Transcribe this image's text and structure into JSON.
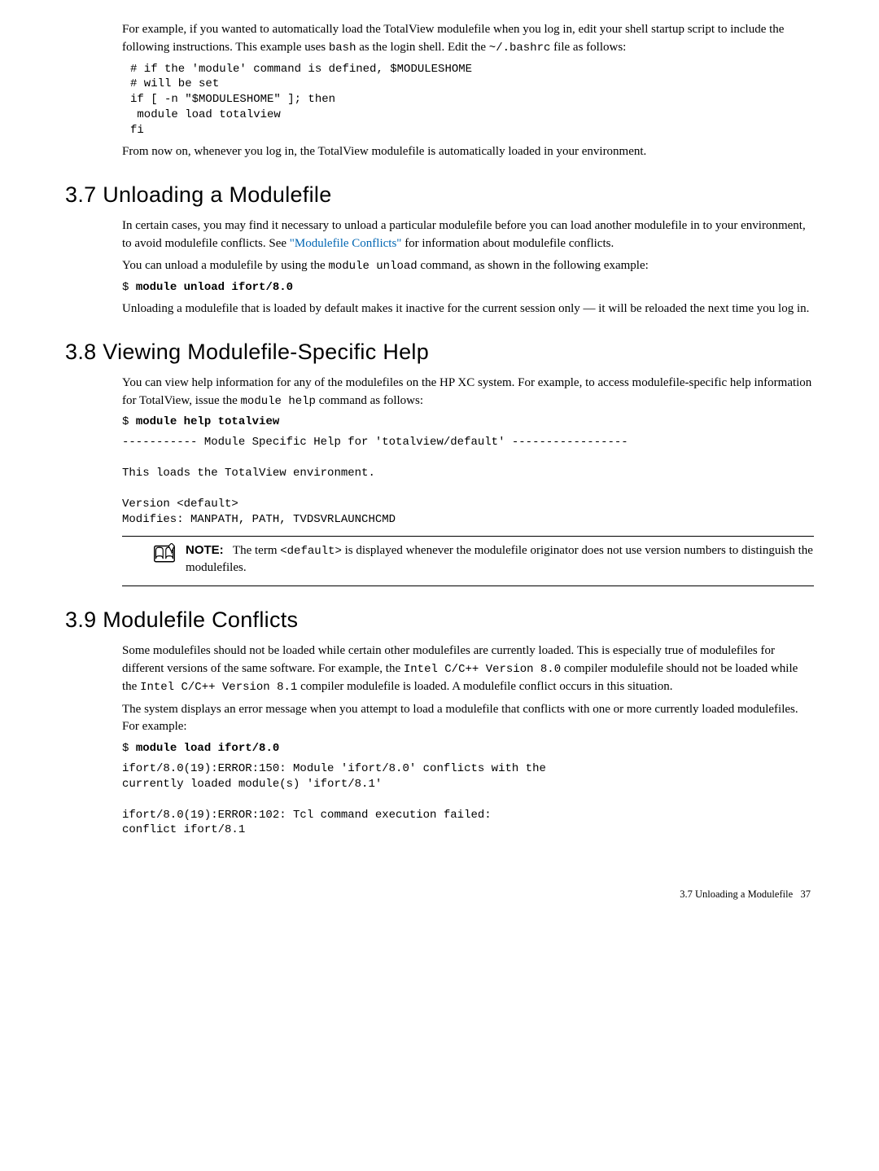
{
  "intro": {
    "p1": "For example, if you wanted to automatically load the TotalView modulefile when you log in, edit your shell startup script to include the following instructions. This example uses ",
    "p1_code1": "bash",
    "p1_mid": " as the login shell. Edit the ",
    "p1_code2": "~/.bashrc",
    "p1_end": " file as follows:",
    "codeblock": "# if the 'module' command is defined, $MODULESHOME\n# will be set\nif [ -n \"$MODULESHOME\" ]; then\n module load totalview\nfi",
    "p2": "From now on, whenever you log in, the TotalView modulefile is automatically loaded in your environment."
  },
  "sec37": {
    "number": "3.7",
    "title": "Unloading a Modulefile",
    "p1_a": "In certain cases, you may find it necessary to unload a particular modulefile before you can load another modulefile in to your environment, to avoid modulefile conflicts. See ",
    "p1_link": "\"Modulefile Conflicts\"",
    "p1_b": " for information about modulefile conflicts.",
    "p2_a": "You can unload a modulefile by using the ",
    "p2_code": "module unload",
    "p2_b": " command, as shown in the following example:",
    "code_prompt": "$ ",
    "code_cmd": "module unload ifort/8.0",
    "p3": "Unloading a modulefile that is loaded by default makes it inactive for the current session only — it will be reloaded the next time you log in."
  },
  "sec38": {
    "number": "3.8",
    "title": "Viewing Modulefile-Specific Help",
    "p1_a": "You can view help information for any of the modulefiles on the HP XC system. For example, to access modulefile-specific help information for TotalView, issue the ",
    "p1_code": "module help",
    "p1_b": " command as follows:",
    "code_prompt": "$ ",
    "code_cmd": "module help totalview",
    "code_out": "----------- Module Specific Help for 'totalview/default' -----------------\n\nThis loads the TotalView environment.\n\nVersion <default>\nModifies: MANPATH, PATH, TVDSVRLAUNCHCMD",
    "note_label": "NOTE:",
    "note_a": "The term ",
    "note_code": "<default>",
    "note_b": " is displayed whenever the modulefile originator does not use version numbers to distinguish the modulefiles."
  },
  "sec39": {
    "number": "3.9",
    "title": "Modulefile Conflicts",
    "p1_a": "Some modulefiles should not be loaded while certain other modulefiles are currently loaded. This is especially true of modulefiles for different versions of the same software. For example, the ",
    "p1_code1": "Intel C/C++ Version 8.0",
    "p1_mid": " compiler modulefile should not be loaded while the ",
    "p1_code2": "Intel C/C++ Version 8.1",
    "p1_b": " compiler modulefile is loaded. A modulefile conflict occurs in this situation.",
    "p2": "The system displays an error message when you attempt to load a modulefile that conflicts with one or more currently loaded modulefiles. For example:",
    "code_prompt": "$ ",
    "code_cmd": "module load ifort/8.0",
    "code_out": "ifort/8.0(19):ERROR:150: Module 'ifort/8.0' conflicts with the\ncurrently loaded module(s) 'ifort/8.1'\n\nifort/8.0(19):ERROR:102: Tcl command execution failed:\nconflict ifort/8.1"
  },
  "footer": {
    "text": "3.7 Unloading a Modulefile",
    "page": "37"
  }
}
